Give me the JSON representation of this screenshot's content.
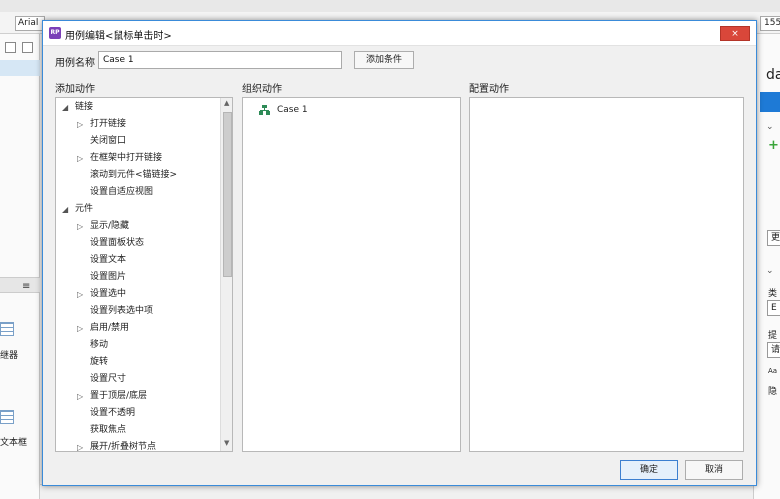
{
  "background": {
    "font_name": "Arial",
    "number_field": "155",
    "right_panel": {
      "title_fragment": "da",
      "label_a": "类",
      "box_a": "E",
      "label_b": "提",
      "box_b": "请",
      "label_c": "Aa",
      "label_d": "隐",
      "box_top": "更"
    },
    "left_panel": {
      "widget_a_label": "继器",
      "widget_b_label": "文本框",
      "menu_icon": "≡"
    }
  },
  "dialog": {
    "title": "用例编辑<鼠标单击时>",
    "app_icon_text": "RP",
    "close_label": "×",
    "case_name_label": "用例名称",
    "case_name_value": "Case 1",
    "add_condition_label": "添加条件",
    "columns": {
      "add_actions": "添加动作",
      "organize_actions": "组织动作",
      "configure_actions": "配置动作"
    },
    "tree": [
      {
        "label": "链接",
        "level": 0,
        "arrow": "◢"
      },
      {
        "label": "打开链接",
        "level": 1,
        "arrow": "▷"
      },
      {
        "label": "关闭窗口",
        "level": 1,
        "arrow": ""
      },
      {
        "label": "在框架中打开链接",
        "level": 1,
        "arrow": "▷"
      },
      {
        "label": "滚动到元件<锚链接>",
        "level": 1,
        "arrow": ""
      },
      {
        "label": "设置自适应视图",
        "level": 1,
        "arrow": ""
      },
      {
        "label": "元件",
        "level": 0,
        "arrow": "◢"
      },
      {
        "label": "显示/隐藏",
        "level": 1,
        "arrow": "▷"
      },
      {
        "label": "设置面板状态",
        "level": 1,
        "arrow": ""
      },
      {
        "label": "设置文本",
        "level": 1,
        "arrow": ""
      },
      {
        "label": "设置图片",
        "level": 1,
        "arrow": ""
      },
      {
        "label": "设置选中",
        "level": 1,
        "arrow": "▷"
      },
      {
        "label": "设置列表选中项",
        "level": 1,
        "arrow": ""
      },
      {
        "label": "启用/禁用",
        "level": 1,
        "arrow": "▷"
      },
      {
        "label": "移动",
        "level": 1,
        "arrow": ""
      },
      {
        "label": "旋转",
        "level": 1,
        "arrow": ""
      },
      {
        "label": "设置尺寸",
        "level": 1,
        "arrow": ""
      },
      {
        "label": "置于顶层/底层",
        "level": 1,
        "arrow": "▷"
      },
      {
        "label": "设置不透明",
        "level": 1,
        "arrow": ""
      },
      {
        "label": "获取焦点",
        "level": 1,
        "arrow": ""
      },
      {
        "label": "展开/折叠树节点",
        "level": 1,
        "arrow": "▷"
      }
    ],
    "organize": {
      "case_label": "Case 1",
      "case_icon": "case-tree-icon"
    },
    "scroll_up": "▲",
    "scroll_down": "▼",
    "ok_label": "确定",
    "cancel_label": "取消"
  },
  "colors": {
    "accent_border": "#3a8bd9",
    "close_red": "#d9473a",
    "app_icon_purple": "#7b3fb8",
    "case_icon_green": "#2e8b57",
    "plus_green": "#3aa53a",
    "panel_blue": "#1e7ad6"
  }
}
